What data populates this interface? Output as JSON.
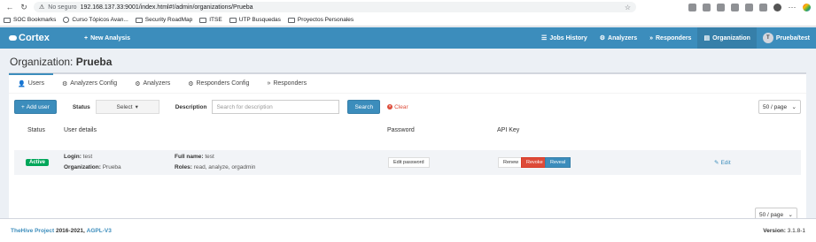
{
  "browser": {
    "secure_label": "No seguro",
    "url": "192.168.137.33:9001/index.html#!/admin/organizations/Prueba"
  },
  "bookmarks": [
    {
      "label": "SOC Bookmarks",
      "icon": "folder-icon"
    },
    {
      "label": "Curso Tópicos Avan...",
      "icon": "globe-icon"
    },
    {
      "label": "Security RoadMap",
      "icon": "folder-icon"
    },
    {
      "label": "ITSE",
      "icon": "folder-icon"
    },
    {
      "label": "UTP Busquedas",
      "icon": "folder-icon"
    },
    {
      "label": "Proyectos Personales",
      "icon": "folder-icon"
    }
  ],
  "navbar": {
    "logo": "Cortex",
    "new_analysis": "New Analysis",
    "items": [
      {
        "label": "Jobs History",
        "icon": "tasks-icon"
      },
      {
        "label": "Analyzers",
        "icon": "cogs-icon"
      },
      {
        "label": "Responders",
        "icon": "forward-icon"
      },
      {
        "label": "Organization",
        "icon": "document-icon"
      }
    ],
    "user_initial": "T",
    "user_label": "Prueba/test"
  },
  "page": {
    "title_prefix": "Organization:",
    "title_name": "Prueba"
  },
  "tabs": [
    {
      "label": "Users",
      "icon": "user-icon"
    },
    {
      "label": "Analyzers Config",
      "icon": "cog-icon"
    },
    {
      "label": "Analyzers",
      "icon": "cogs-icon"
    },
    {
      "label": "Responders Config",
      "icon": "cog-icon"
    },
    {
      "label": "Responders",
      "icon": "forward-icon"
    }
  ],
  "toolbar": {
    "add_user": "Add user",
    "status_label": "Status",
    "status_value": "Select",
    "description_label": "Description",
    "description_placeholder": "Search for description",
    "search": "Search",
    "clear": "Clear",
    "per_page": "50 / page"
  },
  "table": {
    "headers": {
      "status": "Status",
      "user_details": "User details",
      "password": "Password",
      "api_key": "API Key"
    },
    "rows": [
      {
        "status": "Active",
        "login_label": "Login:",
        "login": "test",
        "org_label": "Organization:",
        "org": "Prueba",
        "fullname_label": "Full name:",
        "fullname": "test",
        "roles_label": "Roles:",
        "roles": "read, analyze, orgadmin",
        "edit_password": "Edit password",
        "renew": "Renew",
        "revoke": "Revoke",
        "reveal": "Reveal",
        "edit": "Edit"
      }
    ]
  },
  "footer": {
    "project": "TheHive Project",
    "years": "2016-2021,",
    "license": "AGPL-V3",
    "version_label": "Version:",
    "version": "3.1.8-1"
  },
  "colors": {
    "primary": "#3c8dbc",
    "success": "#00a65a",
    "danger": "#dd4b39"
  }
}
